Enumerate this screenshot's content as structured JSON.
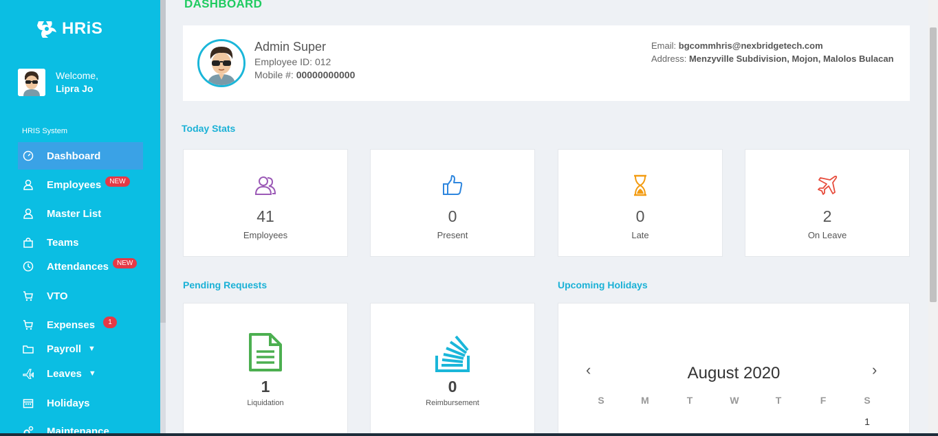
{
  "app": {
    "logo_text": "HRiS",
    "page_title": "DASHBOARD"
  },
  "sidebar": {
    "welcome_label": "Welcome,",
    "user_name": "Lipra Jo",
    "section_title": "HRIS System",
    "items": [
      {
        "label": "Dashboard",
        "icon": "dashboard-icon"
      },
      {
        "label": "Employees",
        "icon": "user-icon",
        "badge": "NEW"
      },
      {
        "label": "Master List",
        "icon": "user-icon"
      },
      {
        "label": "Teams",
        "icon": "bag-icon"
      },
      {
        "label": "Attendances",
        "icon": "clock-icon",
        "badge": "NEW"
      },
      {
        "label": "VTO",
        "icon": "cart-icon"
      },
      {
        "label": "Expenses",
        "icon": "cart-icon",
        "count": "1"
      },
      {
        "label": "Payroll",
        "icon": "folder-icon"
      },
      {
        "label": "Leaves",
        "icon": "plane-icon"
      },
      {
        "label": "Holidays",
        "icon": "calendar-icon"
      },
      {
        "label": "Maintenance",
        "icon": "gears-icon"
      }
    ]
  },
  "profile": {
    "name": "Admin Super",
    "employee_id_label": "Employee ID:",
    "employee_id": "012",
    "mobile_label": "Mobile #:",
    "mobile": "00000000000",
    "email_label": "Email:",
    "email": "bgcommhris@nexbridgetech.com",
    "address_label": "Address:",
    "address": "Menzyville Subdivision, Mojon, Malolos Bulacan"
  },
  "today_stats": {
    "heading": "Today Stats",
    "items": [
      {
        "value": "41",
        "label": "Employees",
        "icon": "users-icon",
        "color": "#9b59b6"
      },
      {
        "value": "0",
        "label": "Present",
        "icon": "thumbs-up-icon",
        "color": "#2e86de"
      },
      {
        "value": "0",
        "label": "Late",
        "icon": "hourglass-icon",
        "color": "#f39c12"
      },
      {
        "value": "2",
        "label": "On Leave",
        "icon": "plane-icon",
        "color": "#e74c3c"
      }
    ]
  },
  "pending_requests": {
    "heading": "Pending Requests",
    "items": [
      {
        "value": "1",
        "label": "Liquidation",
        "icon": "document-icon",
        "color": "#4caf50"
      },
      {
        "value": "0",
        "label": "Reimbursement",
        "icon": "stack-icon",
        "color": "#1ab6d9"
      }
    ]
  },
  "holidays": {
    "heading": "Upcoming Holidays",
    "month": "August 2020",
    "days_of_week": [
      "S",
      "M",
      "T",
      "W",
      "T",
      "F",
      "S"
    ],
    "first_day": "1"
  },
  "colors": {
    "sidebar": "#0bbee3",
    "active": "#3aa2e6",
    "accent": "#1ab1d6",
    "title": "#1fcb60"
  }
}
